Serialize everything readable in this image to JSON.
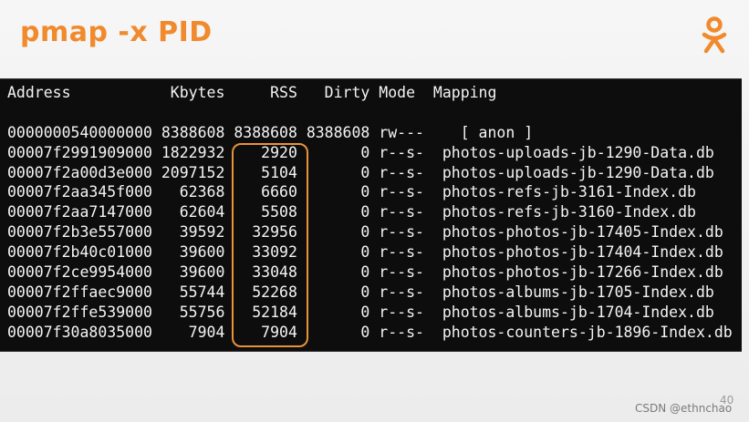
{
  "slide": {
    "title": "pmap -x PID",
    "page_number": "40",
    "watermark": "CSDN @ethnchao",
    "logo_icon": "odnoklassniki-logo-icon",
    "accent_color": "#f08a2c"
  },
  "terminal": {
    "header": "Address           Kbytes     RSS   Dirty Mode  Mapping",
    "blank": "",
    "rows": [
      "0000000540000000 8388608 8388608 8388608 rw---    [ anon ]",
      "00007f2991909000 1822932    2920       0 r--s-  photos-uploads-jb-1290-Data.db",
      "00007f2a00d3e000 2097152    5104       0 r--s-  photos-uploads-jb-1290-Data.db",
      "00007f2aa345f000   62368    6660       0 r--s-  photos-refs-jb-3161-Index.db",
      "00007f2aa7147000   62604    5508       0 r--s-  photos-refs-jb-3160-Index.db",
      "00007f2b3e557000   39592   32956       0 r--s-  photos-photos-jb-17405-Index.db",
      "00007f2b40c01000   39600   33092       0 r--s-  photos-photos-jb-17404-Index.db",
      "00007f2ce9954000   39600   33048       0 r--s-  photos-photos-jb-17266-Index.db",
      "00007f2ffaec9000   55744   52268       0 r--s-  photos-albums-jb-1705-Index.db",
      "00007f2ffe539000   55756   52184       0 r--s-  photos-albums-jb-1704-Index.db",
      "00007f30a8035000    7904    7904       0 r--s-  photos-counters-jb-1896-Index.db"
    ]
  }
}
